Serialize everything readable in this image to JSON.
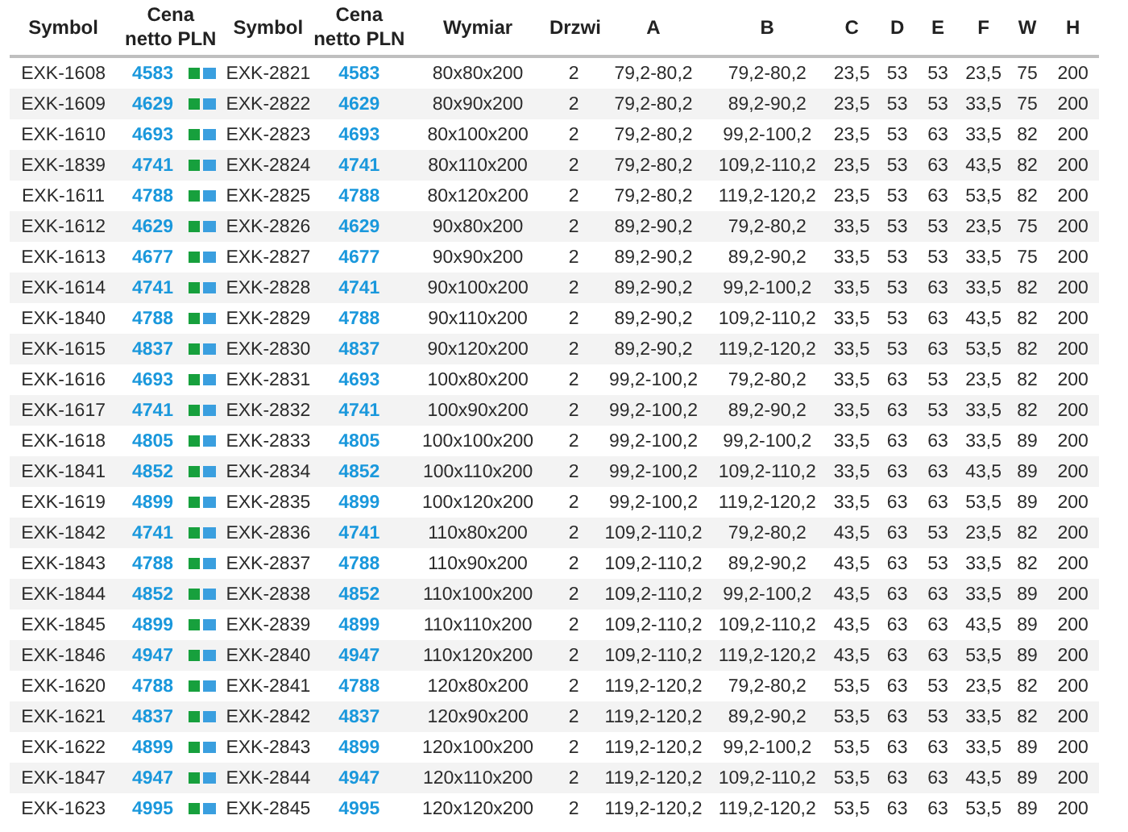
{
  "table": {
    "columns": [
      "Symbol",
      "Cena\nnetto PLN",
      "Symbol",
      "Cena\nnetto PLN",
      "Wymiar",
      "Drzwi",
      "A",
      "B",
      "C",
      "D",
      "E",
      "F",
      "W",
      "H"
    ],
    "rows": [
      [
        "EXK-1608",
        "4583",
        "EXK-2821",
        "4583",
        "80x80x200",
        "2",
        "79,2-80,2",
        "79,2-80,2",
        "23,5",
        "53",
        "53",
        "23,5",
        "75",
        "200"
      ],
      [
        "EXK-1609",
        "4629",
        "EXK-2822",
        "4629",
        "80x90x200",
        "2",
        "79,2-80,2",
        "89,2-90,2",
        "23,5",
        "53",
        "53",
        "33,5",
        "75",
        "200"
      ],
      [
        "EXK-1610",
        "4693",
        "EXK-2823",
        "4693",
        "80x100x200",
        "2",
        "79,2-80,2",
        "99,2-100,2",
        "23,5",
        "53",
        "63",
        "33,5",
        "82",
        "200"
      ],
      [
        "EXK-1839",
        "4741",
        "EXK-2824",
        "4741",
        "80x110x200",
        "2",
        "79,2-80,2",
        "109,2-110,2",
        "23,5",
        "53",
        "63",
        "43,5",
        "82",
        "200"
      ],
      [
        "EXK-1611",
        "4788",
        "EXK-2825",
        "4788",
        "80x120x200",
        "2",
        "79,2-80,2",
        "119,2-120,2",
        "23,5",
        "53",
        "63",
        "53,5",
        "82",
        "200"
      ],
      [
        "EXK-1612",
        "4629",
        "EXK-2826",
        "4629",
        "90x80x200",
        "2",
        "89,2-90,2",
        "79,2-80,2",
        "33,5",
        "53",
        "53",
        "23,5",
        "75",
        "200"
      ],
      [
        "EXK-1613",
        "4677",
        "EXK-2827",
        "4677",
        "90x90x200",
        "2",
        "89,2-90,2",
        "89,2-90,2",
        "33,5",
        "53",
        "53",
        "33,5",
        "75",
        "200"
      ],
      [
        "EXK-1614",
        "4741",
        "EXK-2828",
        "4741",
        "90x100x200",
        "2",
        "89,2-90,2",
        "99,2-100,2",
        "33,5",
        "53",
        "63",
        "33,5",
        "82",
        "200"
      ],
      [
        "EXK-1840",
        "4788",
        "EXK-2829",
        "4788",
        "90x110x200",
        "2",
        "89,2-90,2",
        "109,2-110,2",
        "33,5",
        "53",
        "63",
        "43,5",
        "82",
        "200"
      ],
      [
        "EXK-1615",
        "4837",
        "EXK-2830",
        "4837",
        "90x120x200",
        "2",
        "89,2-90,2",
        "119,2-120,2",
        "33,5",
        "53",
        "63",
        "53,5",
        "82",
        "200"
      ],
      [
        "EXK-1616",
        "4693",
        "EXK-2831",
        "4693",
        "100x80x200",
        "2",
        "99,2-100,2",
        "79,2-80,2",
        "33,5",
        "63",
        "53",
        "23,5",
        "82",
        "200"
      ],
      [
        "EXK-1617",
        "4741",
        "EXK-2832",
        "4741",
        "100x90x200",
        "2",
        "99,2-100,2",
        "89,2-90,2",
        "33,5",
        "63",
        "53",
        "33,5",
        "82",
        "200"
      ],
      [
        "EXK-1618",
        "4805",
        "EXK-2833",
        "4805",
        "100x100x200",
        "2",
        "99,2-100,2",
        "99,2-100,2",
        "33,5",
        "63",
        "63",
        "33,5",
        "89",
        "200"
      ],
      [
        "EXK-1841",
        "4852",
        "EXK-2834",
        "4852",
        "100x110x200",
        "2",
        "99,2-100,2",
        "109,2-110,2",
        "33,5",
        "63",
        "63",
        "43,5",
        "89",
        "200"
      ],
      [
        "EXK-1619",
        "4899",
        "EXK-2835",
        "4899",
        "100x120x200",
        "2",
        "99,2-100,2",
        "119,2-120,2",
        "33,5",
        "63",
        "63",
        "53,5",
        "89",
        "200"
      ],
      [
        "EXK-1842",
        "4741",
        "EXK-2836",
        "4741",
        "110x80x200",
        "2",
        "109,2-110,2",
        "79,2-80,2",
        "43,5",
        "63",
        "53",
        "23,5",
        "82",
        "200"
      ],
      [
        "EXK-1843",
        "4788",
        "EXK-2837",
        "4788",
        "110x90x200",
        "2",
        "109,2-110,2",
        "89,2-90,2",
        "43,5",
        "63",
        "53",
        "33,5",
        "82",
        "200"
      ],
      [
        "EXK-1844",
        "4852",
        "EXK-2838",
        "4852",
        "110x100x200",
        "2",
        "109,2-110,2",
        "99,2-100,2",
        "43,5",
        "63",
        "63",
        "33,5",
        "89",
        "200"
      ],
      [
        "EXK-1845",
        "4899",
        "EXK-2839",
        "4899",
        "110x110x200",
        "2",
        "109,2-110,2",
        "109,2-110,2",
        "43,5",
        "63",
        "63",
        "43,5",
        "89",
        "200"
      ],
      [
        "EXK-1846",
        "4947",
        "EXK-2840",
        "4947",
        "110x120x200",
        "2",
        "109,2-110,2",
        "119,2-120,2",
        "43,5",
        "63",
        "63",
        "53,5",
        "89",
        "200"
      ],
      [
        "EXK-1620",
        "4788",
        "EXK-2841",
        "4788",
        "120x80x200",
        "2",
        "119,2-120,2",
        "79,2-80,2",
        "53,5",
        "63",
        "53",
        "23,5",
        "82",
        "200"
      ],
      [
        "EXK-1621",
        "4837",
        "EXK-2842",
        "4837",
        "120x90x200",
        "2",
        "119,2-120,2",
        "89,2-90,2",
        "53,5",
        "63",
        "53",
        "33,5",
        "82",
        "200"
      ],
      [
        "EXK-1622",
        "4899",
        "EXK-2843",
        "4899",
        "120x100x200",
        "2",
        "119,2-120,2",
        "99,2-100,2",
        "53,5",
        "63",
        "63",
        "33,5",
        "89",
        "200"
      ],
      [
        "EXK-1847",
        "4947",
        "EXK-2844",
        "4947",
        "120x110x200",
        "2",
        "119,2-120,2",
        "109,2-110,2",
        "53,5",
        "63",
        "63",
        "43,5",
        "89",
        "200"
      ],
      [
        "EXK-1623",
        "4995",
        "EXK-2845",
        "4995",
        "120x120x200",
        "2",
        "119,2-120,2",
        "119,2-120,2",
        "53,5",
        "63",
        "63",
        "53,5",
        "89",
        "200"
      ]
    ]
  }
}
